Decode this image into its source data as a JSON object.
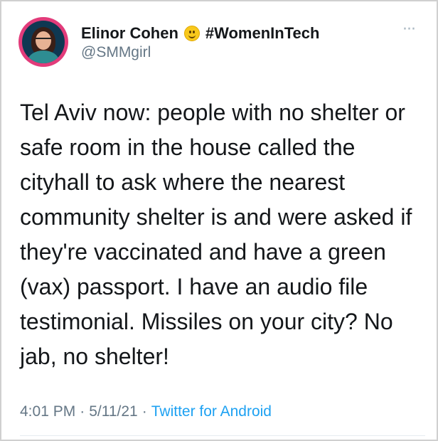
{
  "tweet": {
    "author_name": "Elinor Cohen",
    "emoji": "smiling-face-emoji",
    "hashtag": "#WomenInTech",
    "handle": "@SMMgirl",
    "text": "Tel Aviv now: people with no shelter or safe room in the house called the cityhall to ask where the nearest community shelter is and were asked if they're vaccinated and have a green (vax) passport. I have an audio file testimonial. Missiles on your city? No jab, no shelter!",
    "time": "4:01 PM",
    "date": "5/11/21",
    "source": "Twitter for Android",
    "separator": "·",
    "more_icon": "···"
  },
  "colors": {
    "text": "#14171a",
    "secondary": "#657786",
    "link": "#1da1f2",
    "avatar_ring": "#e23b7a"
  }
}
